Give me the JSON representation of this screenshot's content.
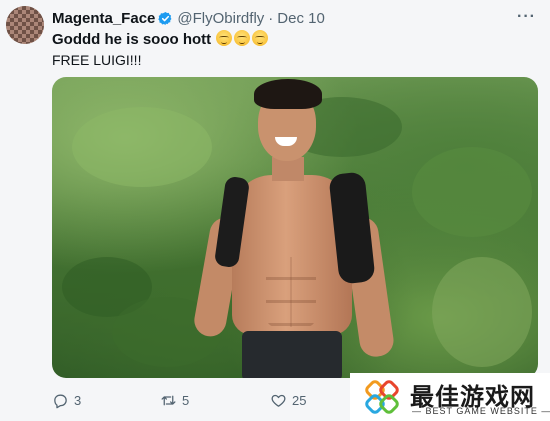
{
  "tweet": {
    "author_name": "Magenta_Face",
    "handle": "@FlyObirdfly",
    "separator": "·",
    "date": "Dec 10",
    "more": "···",
    "text_line1": "Goddd he is sooo hott",
    "emoji_count": 3,
    "text_line2": "FREE LUIGI!!!",
    "replies": "3",
    "retweets": "5",
    "likes": "25"
  },
  "watermark": {
    "title": "最佳游戏网",
    "subtitle": "— BEST GAME WEBSITE —"
  },
  "colors": {
    "verified": "#1d9bf0",
    "muted": "#536471",
    "background": "#f5f6f8"
  },
  "icons": [
    "verified-badge-icon",
    "more-icon",
    "reply-icon",
    "retweet-icon",
    "like-icon",
    "site-logo-icon"
  ]
}
